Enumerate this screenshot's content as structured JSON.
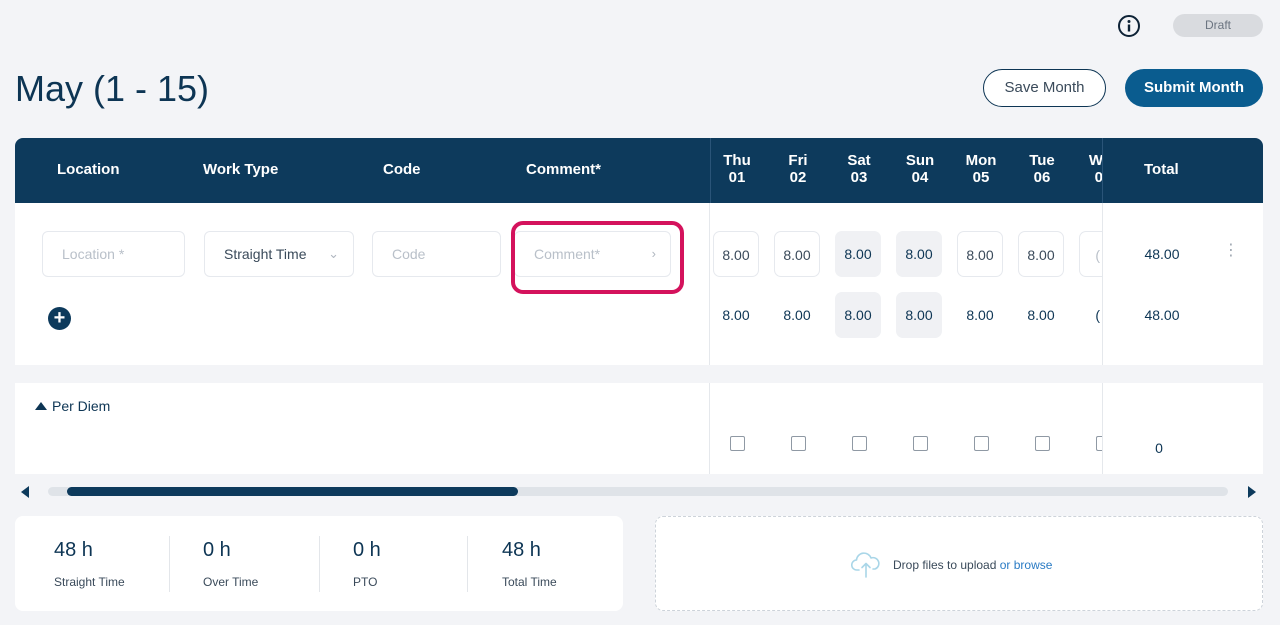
{
  "status": "Draft",
  "title": "May (1 - 15)",
  "actions": {
    "save": "Save Month",
    "submit": "Submit Month"
  },
  "columns": {
    "location": "Location",
    "work_type": "Work Type",
    "code": "Code",
    "comment": "Comment*",
    "total": "Total"
  },
  "days": [
    {
      "dow": "Thu",
      "num": "01"
    },
    {
      "dow": "Fri",
      "num": "02"
    },
    {
      "dow": "Sat",
      "num": "03"
    },
    {
      "dow": "Sun",
      "num": "04"
    },
    {
      "dow": "Mon",
      "num": "05"
    },
    {
      "dow": "Tue",
      "num": "06"
    },
    {
      "dow": "W",
      "num": "0"
    }
  ],
  "entry": {
    "location_placeholder": "Location *",
    "work_type": "Straight Time",
    "code_placeholder": "Code",
    "comment_placeholder": "Comment*",
    "hours": [
      "8.00",
      "8.00",
      "8.00",
      "8.00",
      "8.00",
      "8.00",
      "("
    ],
    "total": "48.00"
  },
  "daily_totals": {
    "hours": [
      "8.00",
      "8.00",
      "8.00",
      "8.00",
      "8.00",
      "8.00",
      "("
    ],
    "total": "48.00"
  },
  "per_diem": {
    "label": "Per Diem",
    "total": "0"
  },
  "summary": [
    {
      "value": "48 h",
      "label": "Straight Time"
    },
    {
      "value": "0 h",
      "label": "Over Time"
    },
    {
      "value": "0 h",
      "label": "PTO"
    },
    {
      "value": "48 h",
      "label": "Total Time"
    }
  ],
  "upload": {
    "text": "Drop files to upload",
    "link": "or browse"
  },
  "colors": {
    "navy": "#0d3a5c",
    "accent_blue": "#0a5c8f",
    "highlight": "#d4125c"
  }
}
